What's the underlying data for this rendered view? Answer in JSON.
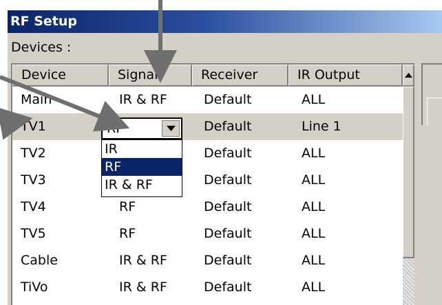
{
  "window": {
    "title": "RF Setup"
  },
  "devices_label": "Devices :",
  "table": {
    "columns": [
      "Device",
      "Signal",
      "Receiver",
      "IR Output"
    ],
    "rows": [
      {
        "device": "Main",
        "signal": "IR & RF",
        "receiver": "Default",
        "ir_output": "ALL"
      },
      {
        "device": "TV1",
        "signal": "RF",
        "receiver": "Default",
        "ir_output": "Line 1"
      },
      {
        "device": "TV2",
        "signal": "",
        "receiver": "Default",
        "ir_output": "ALL"
      },
      {
        "device": "TV3",
        "signal": "",
        "receiver": "Default",
        "ir_output": "ALL"
      },
      {
        "device": "TV4",
        "signal": "RF",
        "receiver": "Default",
        "ir_output": "ALL"
      },
      {
        "device": "TV5",
        "signal": "RF",
        "receiver": "Default",
        "ir_output": "ALL"
      },
      {
        "device": "Cable",
        "signal": "IR & RF",
        "receiver": "Default",
        "ir_output": "ALL"
      },
      {
        "device": "TiVo",
        "signal": "IR & RF",
        "receiver": "Default",
        "ir_output": "ALL"
      }
    ]
  },
  "signal_combo": {
    "value": "RF",
    "options": [
      "IR",
      "RF",
      "IR & RF"
    ],
    "highlighted": "RF"
  },
  "colors": {
    "accent": "#0a246a",
    "arrow": "#6f6f6f",
    "selected_row": "#d4d0c8"
  }
}
